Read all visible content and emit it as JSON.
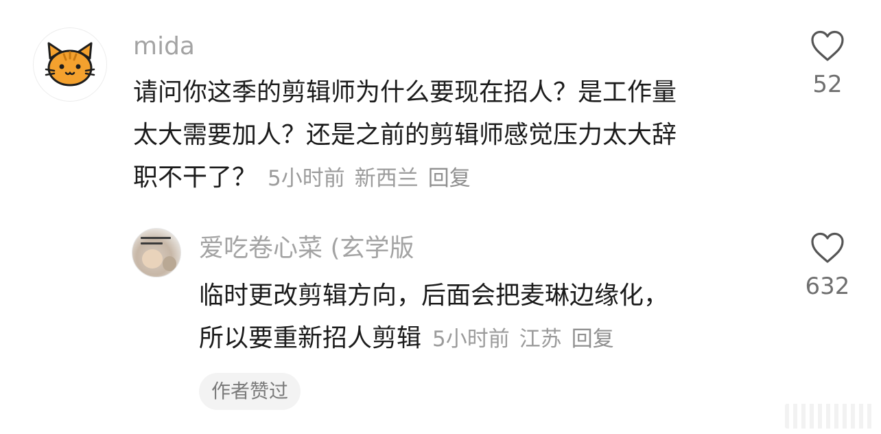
{
  "comment": {
    "username": "mida",
    "avatar_icon": "cat-face-icon",
    "text_lines": [
      "请问你这季的剪辑师为什么要现在招人？是工作量",
      "太大需要加人？还是之前的剪辑师感觉压力太大辞",
      "职不干了？"
    ],
    "time": "5小时前",
    "location": "新西兰",
    "reply_label": "回复",
    "like_count": "52"
  },
  "reply": {
    "username": "爱吃卷心菜 (玄学版",
    "text_lines": [
      "临时更改剪辑方向，后面会把麦琳边缘化，",
      "所以要重新招人剪辑"
    ],
    "time": "5小时前",
    "location": "江苏",
    "reply_label": "回复",
    "like_count": "632",
    "badge": "作者赞过"
  },
  "colors": {
    "username": "#a3a3a3",
    "body_text": "#1b1b1b",
    "meta": "#9b9b9b",
    "heart_stroke": "#555555",
    "cat_orange": "#f4a12e"
  },
  "icons": {
    "like": "heart-outline-icon"
  }
}
